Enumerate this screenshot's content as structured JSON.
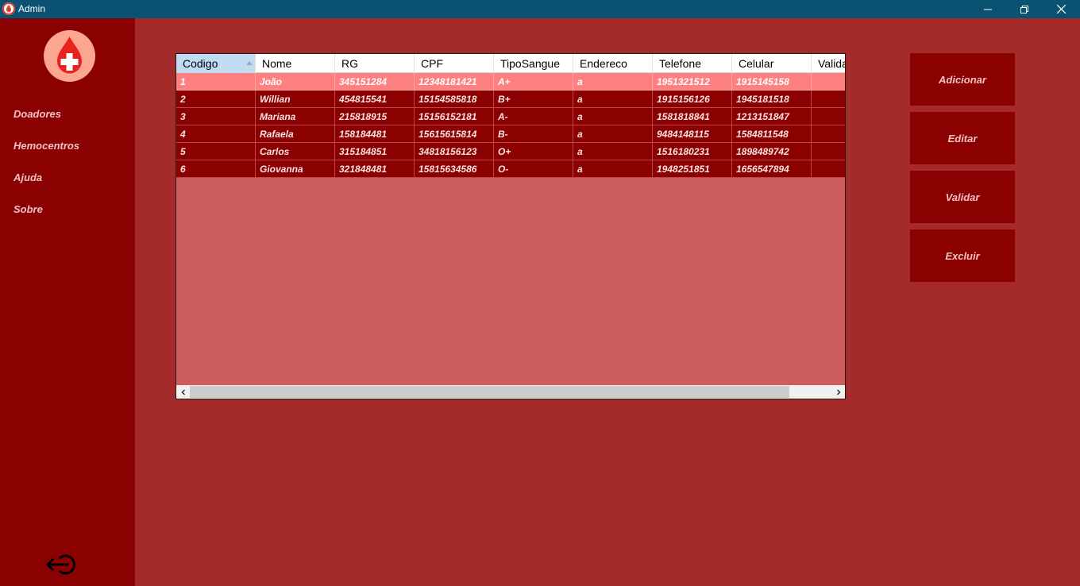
{
  "window": {
    "title": "Admin",
    "minimize_icon": "minimize-icon",
    "maximize_icon": "restore-icon",
    "close_icon": "close-icon"
  },
  "colors": {
    "titlebar": "#0a5272",
    "sidebar": "#8b0000",
    "background": "#a52a2a",
    "grid_background": "#cd5c5c",
    "row": "#8b0000",
    "selected_row": "#ff8080",
    "header_sorted": "#bfdcf3"
  },
  "sidebar": {
    "logo": "blood-drop-cross-icon",
    "items": [
      {
        "label": "Doadores"
      },
      {
        "label": "Hemocentros"
      },
      {
        "label": "Ajuda"
      },
      {
        "label": "Sobre"
      }
    ],
    "logout_icon": "logout-icon"
  },
  "grid": {
    "columns": [
      "Codigo",
      "Nome",
      "RG",
      "CPF",
      "TipoSangue",
      "Endereco",
      "Telefone",
      "Celular",
      "Valida"
    ],
    "sorted_column": "Codigo",
    "selected_row": 0,
    "rows": [
      [
        "1",
        "João",
        "345151284",
        "12348181421",
        "A+",
        "a",
        "1951321512",
        "1915145158",
        ""
      ],
      [
        "2",
        "Willian",
        "454815541",
        "15154585818",
        "B+",
        "a",
        "1915156126",
        "1945181518",
        ""
      ],
      [
        "3",
        "Mariana",
        "215818915",
        "15156152181",
        "A-",
        "a",
        "1581818841",
        "1213151847",
        ""
      ],
      [
        "4",
        "Rafaela",
        "158184481",
        "15615615814",
        "B-",
        "a",
        "9484148115",
        "1584811548",
        ""
      ],
      [
        "5",
        "Carlos",
        "315184851",
        "34818156123",
        "O+",
        "a",
        "1516180231",
        "1898489742",
        ""
      ],
      [
        "6",
        "Giovanna",
        "321848481",
        "15815634586",
        "O-",
        "a",
        "1948251851",
        "1656547894",
        ""
      ]
    ]
  },
  "actions": {
    "add": "Adicionar",
    "edit": "Editar",
    "validate": "Validar",
    "delete": "Excluir"
  }
}
